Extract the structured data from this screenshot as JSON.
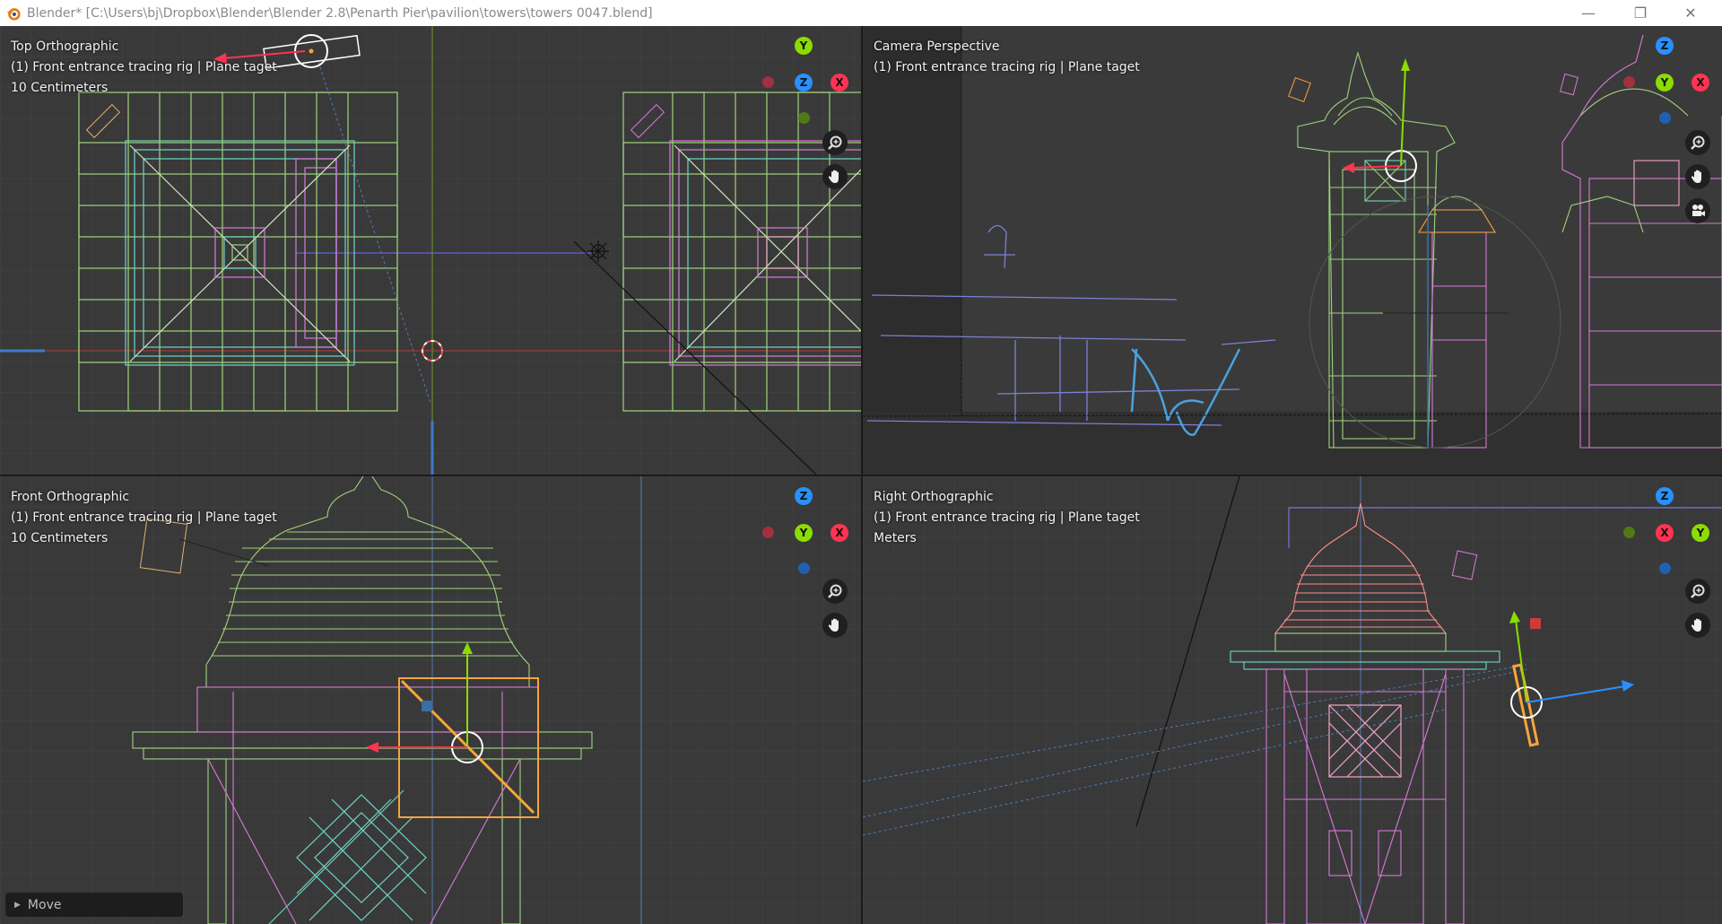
{
  "window": {
    "title": "Blender* [C:\\Users\\bj\\Dropbox\\Blender\\Blender 2.8\\Penarth Pier\\pavilion\\towers\\towers 0047.blend]",
    "controls": {
      "minimize": "—",
      "restore": "❐",
      "close": "✕"
    }
  },
  "viewports": {
    "top_left": {
      "view_name": "Top Orthographic",
      "object": "(1) Front entrance tracing rig | Plane taget",
      "scale": "10 Centimeters",
      "gizmo": {
        "up": "Y",
        "center": "Z",
        "right": "X"
      }
    },
    "top_right": {
      "view_name": "Camera Perspective",
      "object": "(1) Front entrance tracing rig | Plane taget",
      "scale": "",
      "gizmo": {
        "up": "Z",
        "center": "Y",
        "right": "X"
      }
    },
    "bottom_left": {
      "view_name": "Front Orthographic",
      "object": "(1) Front entrance tracing rig | Plane taget",
      "scale": "10 Centimeters",
      "gizmo": {
        "up": "Z",
        "center": "Y",
        "right": "X"
      }
    },
    "bottom_right": {
      "view_name": "Right Orthographic",
      "object": "(1) Front entrance tracing rig | Plane taget",
      "scale": "Meters",
      "gizmo": {
        "up": "Z",
        "center": "X",
        "right": "Y"
      }
    }
  },
  "operator_panel": {
    "label": "Move"
  },
  "colors": {
    "axis_x": "#ff3352",
    "axis_y": "#8bdc00",
    "axis_z": "#2890ff",
    "viewport_bg": "#393939",
    "grid": "#454545",
    "wire_green": "#9fd47c",
    "wire_pink": "#d77ad8",
    "wire_teal": "#6fd5c6",
    "selected": "#f6a53b"
  },
  "icons": [
    "blender-logo-icon",
    "zoom-icon",
    "hand-pan-icon",
    "camera-icon",
    "3d-cursor-icon",
    "light-icon"
  ]
}
